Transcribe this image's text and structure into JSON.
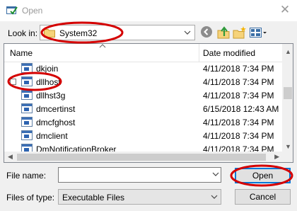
{
  "window": {
    "title": "Open",
    "close_glyph": "✕"
  },
  "lookin": {
    "label": "Look in:",
    "value": "System32"
  },
  "toolbar": {
    "buttons": [
      {
        "name": "back-icon"
      },
      {
        "name": "up-folder-icon"
      },
      {
        "name": "new-folder-icon"
      },
      {
        "name": "view-menu-icon"
      }
    ]
  },
  "filelist": {
    "columns": {
      "name": "Name",
      "date": "Date modified"
    },
    "rows": [
      {
        "name": "dkjoin",
        "date": "4/11/2018 7:34 PM"
      },
      {
        "name": "dllhost",
        "date": "4/11/2018 7:34 PM"
      },
      {
        "name": "dllhst3g",
        "date": "4/11/2018 7:34 PM"
      },
      {
        "name": "dmcertinst",
        "date": "6/15/2018 12:43 AM"
      },
      {
        "name": "dmcfghost",
        "date": "4/11/2018 7:34 PM"
      },
      {
        "name": "dmclient",
        "date": "4/11/2018 7:34 PM"
      },
      {
        "name": "DmNotificationBroker",
        "date": "4/11/2018 7:34 PM"
      }
    ]
  },
  "form": {
    "file_name_label": "File name:",
    "file_name_value": "",
    "file_type_label": "Files of type:",
    "file_type_value": "Executable Files",
    "open_label": "Open",
    "cancel_label": "Cancel"
  },
  "colors": {
    "accent": "#0078d7",
    "annotation": "#d40000"
  }
}
